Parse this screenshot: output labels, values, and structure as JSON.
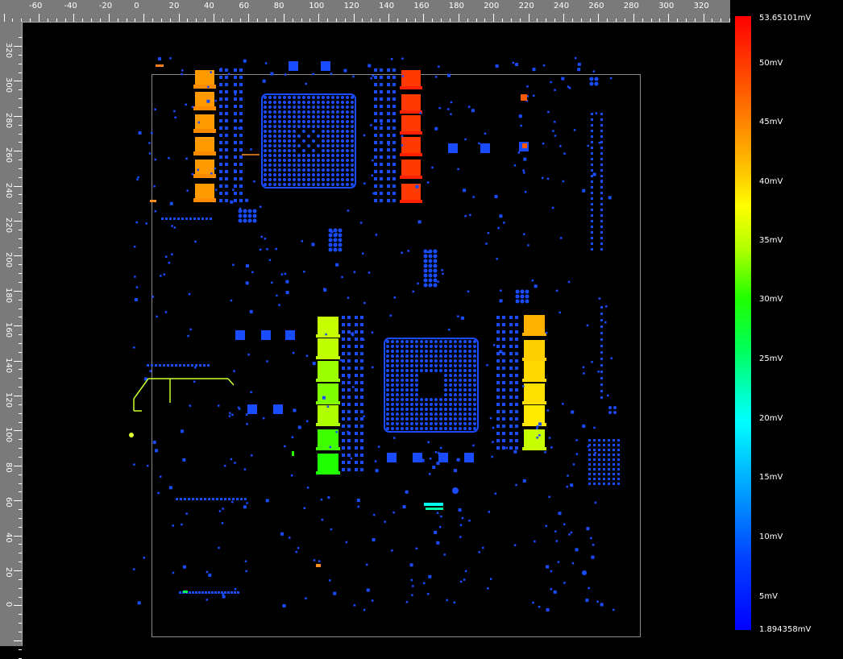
{
  "ruler": {
    "top_ticks": [
      "-60",
      "-40",
      "-20",
      "0",
      "20",
      "40",
      "60",
      "80",
      "100",
      "120",
      "140",
      "160",
      "180",
      "200",
      "220",
      "240",
      "260",
      "280",
      "300",
      "320"
    ],
    "left_ticks": [
      "320",
      "300",
      "280",
      "260",
      "240",
      "220",
      "200",
      "180",
      "160",
      "140",
      "120",
      "100",
      "80",
      "60",
      "40",
      "20",
      "0"
    ]
  },
  "legend": {
    "max_label": "53.65101mV",
    "min_label": "1.894358mV",
    "labels": [
      "50mV",
      "45mV",
      "40mV",
      "35mV",
      "30mV",
      "25mV",
      "20mV",
      "15mV",
      "10mV",
      "5mV"
    ],
    "colors": {
      "max": "#ff0000",
      "high": "#ff8c00",
      "mid": "#ffff00",
      "midlow": "#00ff33",
      "low": "#00ffff",
      "min": "#0000ff"
    }
  },
  "board": {
    "outline_color": "#8a8a8a",
    "component_color": "#1a4cff"
  }
}
